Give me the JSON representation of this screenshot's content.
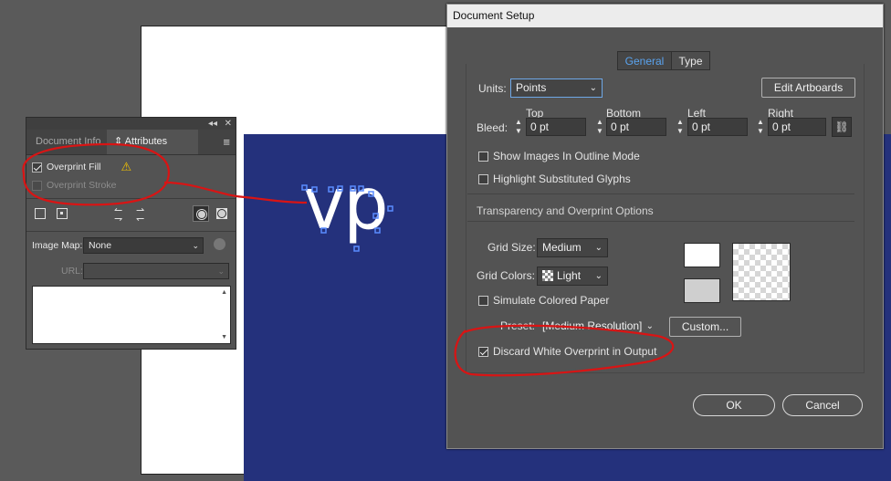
{
  "artwork": {
    "text": "vp"
  },
  "attributes_panel": {
    "tabs": [
      "Document Info",
      "Attributes"
    ],
    "collapse_glyph": "◂◂",
    "close_glyph": "✕",
    "overprint_fill": {
      "label": "Overprint Fill",
      "checked": true
    },
    "overprint_stroke": {
      "label": "Overprint Stroke",
      "checked": false
    },
    "image_map": {
      "label": "Image Map:",
      "value": "None"
    },
    "url": {
      "label": "URL:",
      "value": ""
    }
  },
  "document_setup": {
    "title": "Document Setup",
    "tabs": {
      "general": "General",
      "type": "Type"
    },
    "units_label": "Units:",
    "units_value": "Points",
    "edit_artboards": "Edit Artboards",
    "bleed_label": "Bleed:",
    "bleed_headers": {
      "top": "Top",
      "bottom": "Bottom",
      "left": "Left",
      "right": "Right"
    },
    "bleed_values": {
      "top": "0 pt",
      "bottom": "0 pt",
      "left": "0 pt",
      "right": "0 pt"
    },
    "show_images_outline": "Show Images In Outline Mode",
    "highlight_glyphs": "Highlight Substituted Glyphs",
    "section_title": "Transparency and Overprint Options",
    "grid_size_label": "Grid Size:",
    "grid_size_value": "Medium",
    "grid_colors_label": "Grid Colors:",
    "grid_colors_value": "Light",
    "simulate_paper": "Simulate Colored Paper",
    "preset_label": "Preset:",
    "preset_value": "[Medium Resolution]",
    "custom_button": "Custom...",
    "discard_white": {
      "label": "Discard White Overprint in Output",
      "checked": true
    },
    "ok": "OK",
    "cancel": "Cancel"
  },
  "colors": {
    "annotation": "#d91414",
    "artwork_blue": "#24317c",
    "accent_blue": "#5aa3ee"
  }
}
